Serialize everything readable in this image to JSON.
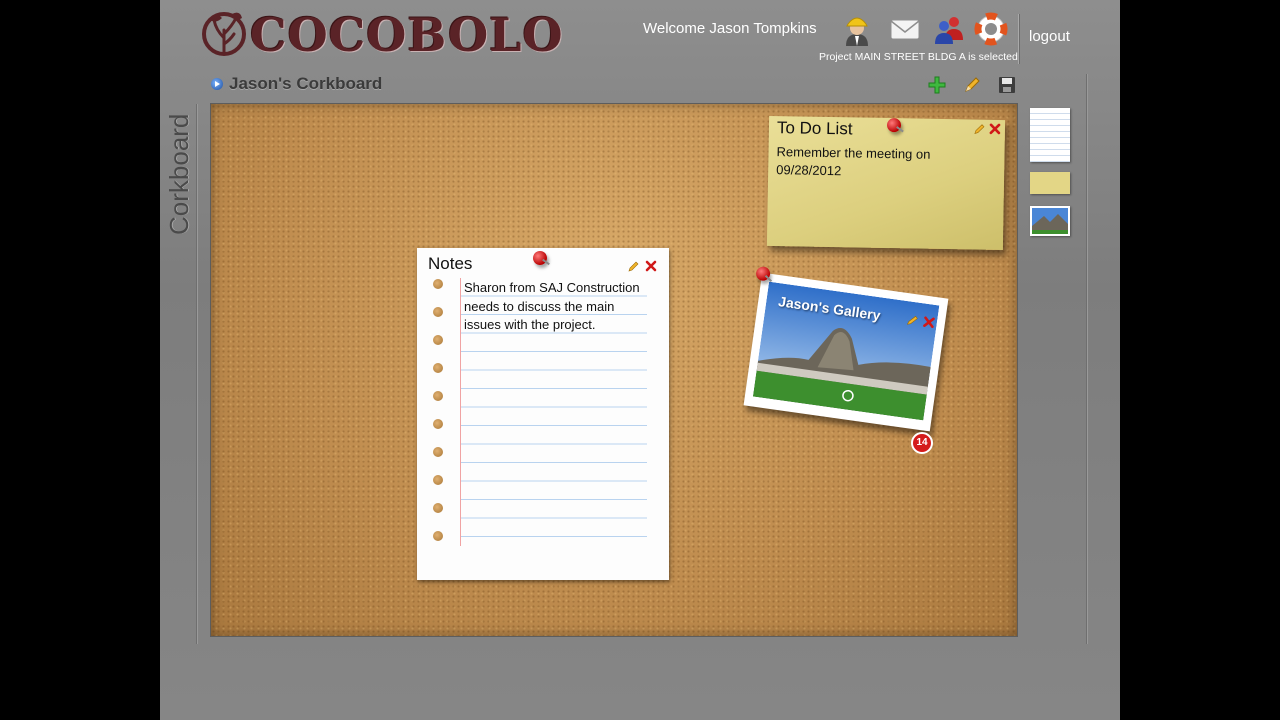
{
  "header": {
    "brand": "COCOBOLO",
    "welcome": "Welcome Jason Tompkins",
    "project_status": "Project MAIN STREET BLDG A is selected",
    "logout": "logout",
    "icons": [
      "worker-avatar-icon",
      "mail-icon",
      "users-icon",
      "help-lifebuoy-icon"
    ]
  },
  "board": {
    "title": "Jason's Corkboard",
    "side_label": "Corkboard",
    "tools": [
      "add-icon",
      "edit-pencil-icon",
      "save-disk-icon"
    ]
  },
  "cards": {
    "notes": {
      "title": "Notes",
      "body": "Sharon from SAJ Construction needs to discuss the main issues with the project."
    },
    "todo": {
      "title": "To Do List",
      "body": "Remember the meeting on 09/28/2012"
    },
    "gallery": {
      "title": "Jason's Gallery",
      "count": "14"
    }
  },
  "colors": {
    "brand": "#5a2327",
    "cork": "#c79555",
    "sticky": "#dccf7e",
    "badge": "#d41b1b"
  }
}
